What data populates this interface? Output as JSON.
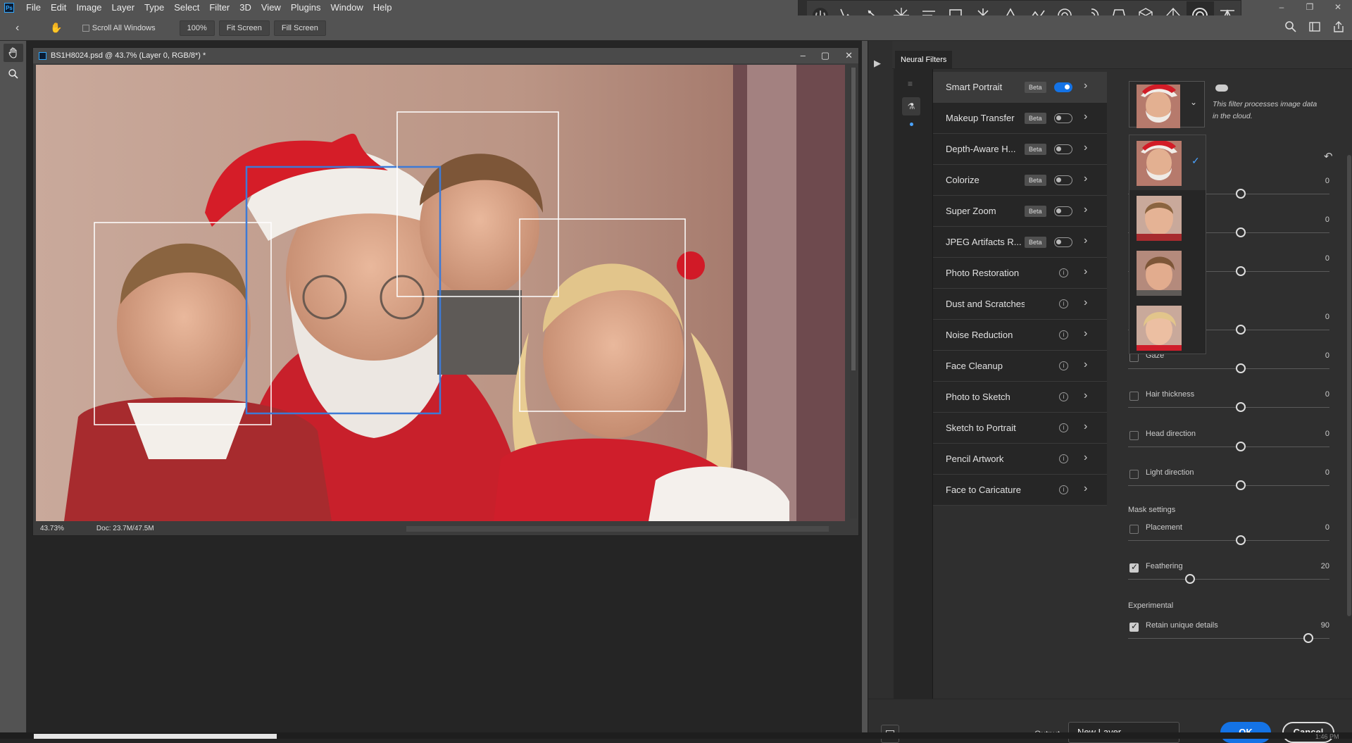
{
  "menu": {
    "items": [
      "File",
      "Edit",
      "Image",
      "Layer",
      "Type",
      "Select",
      "Filter",
      "3D",
      "View",
      "Plugins",
      "Window",
      "Help"
    ]
  },
  "options": {
    "scroll_all_windows": "Scroll All Windows",
    "zoom_100": "100%",
    "fit_screen": "Fit Screen",
    "fill_screen": "Fill Screen"
  },
  "document": {
    "title": "BS1H8024.psd @ 43.7% (Layer 0, RGB/8*) *",
    "zoom": "43.73%",
    "doc_size": "Doc: 23.7M/47.5M"
  },
  "panel": {
    "tab": "Neural Filters",
    "filters": [
      {
        "name": "Smart Portrait",
        "badge": "Beta",
        "enabled": true
      },
      {
        "name": "Makeup Transfer",
        "badge": "Beta",
        "enabled": false
      },
      {
        "name": "Depth-Aware H...",
        "badge": "Beta",
        "enabled": false
      },
      {
        "name": "Colorize",
        "badge": "Beta",
        "enabled": false
      },
      {
        "name": "Super Zoom",
        "badge": "Beta",
        "enabled": false
      },
      {
        "name": "JPEG Artifacts R...",
        "badge": "Beta",
        "enabled": false
      },
      {
        "name": "Photo Restoration"
      },
      {
        "name": "Dust and Scratches"
      },
      {
        "name": "Noise Reduction"
      },
      {
        "name": "Face Cleanup"
      },
      {
        "name": "Photo to Sketch"
      },
      {
        "name": "Sketch to Portrait"
      },
      {
        "name": "Pencil Artwork"
      },
      {
        "name": "Face to Caricature"
      }
    ],
    "cloud_note": "This filter processes image data in the cloud.",
    "sliders": [
      {
        "label": "",
        "value": "0"
      },
      {
        "label": "",
        "value": "0"
      },
      {
        "label": "",
        "value": "0"
      },
      {
        "label": "",
        "value": "0"
      },
      {
        "label": "Gaze",
        "value": "0"
      },
      {
        "label": "Hair thickness",
        "value": "0"
      },
      {
        "label": "Head direction",
        "value": "0"
      },
      {
        "label": "Light direction",
        "value": "0"
      }
    ],
    "mask_settings": "Mask settings",
    "placement": {
      "label": "Placement",
      "value": "0"
    },
    "feathering": {
      "label": "Feathering",
      "value": "20"
    },
    "experimental": "Experimental",
    "retain": {
      "label": "Retain unique details",
      "value": "90"
    },
    "output_label": "Output",
    "output_value": "New Layer",
    "ok": "OK",
    "cancel": "Cancel"
  },
  "clock": "1:46 PM"
}
